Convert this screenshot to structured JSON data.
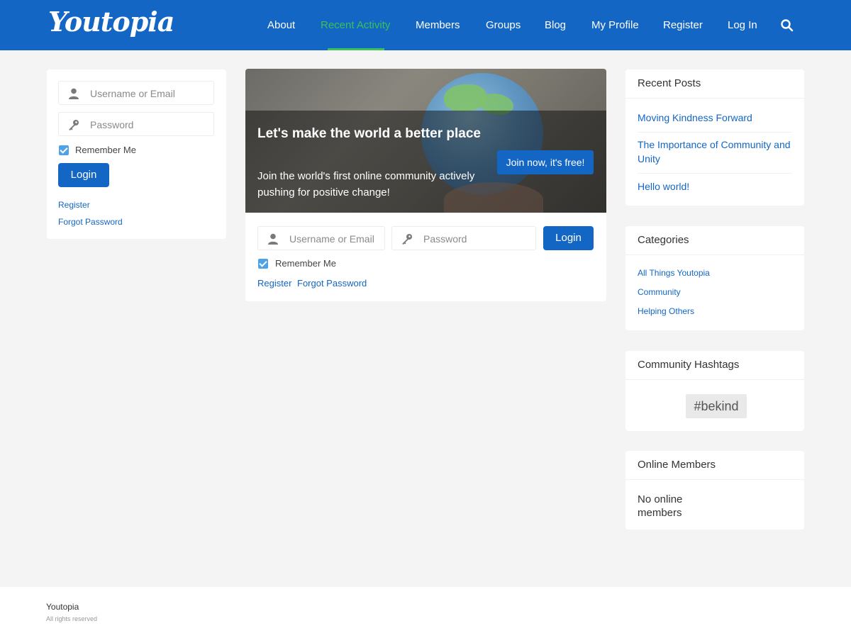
{
  "brand": {
    "logo": "Youtopia"
  },
  "nav": {
    "items": [
      {
        "label": "About"
      },
      {
        "label": "Recent Activity",
        "active": true
      },
      {
        "label": "Members"
      },
      {
        "label": "Groups"
      },
      {
        "label": "Blog"
      },
      {
        "label": "My Profile"
      },
      {
        "label": "Register"
      },
      {
        "label": "Log In"
      }
    ],
    "search_icon": "search-icon"
  },
  "left_login": {
    "username_placeholder": "Username or Email",
    "password_placeholder": "Password",
    "remember_label": "Remember Me",
    "remember_checked": true,
    "login_label": "Login",
    "register_link": "Register",
    "forgot_link": "Forgot Password"
  },
  "hero": {
    "title": "Let's make the world a better place",
    "subtitle": "Join the world's first online community actively pushing for positive change!",
    "cta": "Join now, it's free!"
  },
  "main_login": {
    "username_placeholder": "Username or Email",
    "password_placeholder": "Password",
    "login_label": "Login",
    "remember_label": "Remember Me",
    "remember_checked": true,
    "register_link": "Register",
    "forgot_link": "Forgot Password"
  },
  "recent_posts": {
    "title": "Recent Posts",
    "items": [
      "Moving Kindness Forward",
      "The Importance of Community and Unity",
      "Hello world!"
    ]
  },
  "categories": {
    "title": "Categories",
    "items": [
      "All Things Youtopia",
      "Community",
      "Helping Others"
    ]
  },
  "hashtags": {
    "title": "Community Hashtags",
    "tag": "#bekind"
  },
  "online_members": {
    "title": "Online Members",
    "text": "No online members"
  },
  "footer": {
    "name": "Youtopia",
    "rights": "All rights reserved"
  },
  "colors": {
    "primary": "#1366c4",
    "active_nav": "#3ac15a",
    "background": "#f4f4f4",
    "checkbox": "#4ea3e8"
  }
}
